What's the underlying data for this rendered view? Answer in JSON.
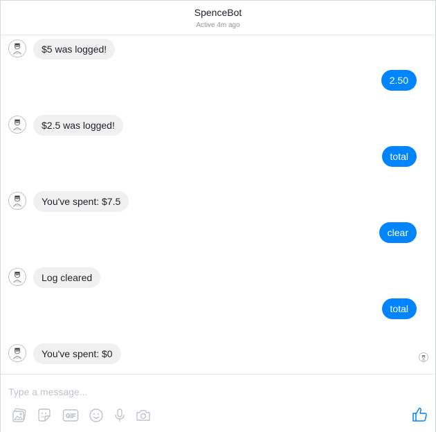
{
  "header": {
    "title": "SpenceBot",
    "status": "Active 4m ago"
  },
  "messages": [
    {
      "from": "bot",
      "text": "$5 was logged!"
    },
    {
      "from": "user",
      "text": "2.50"
    },
    {
      "from": "bot",
      "text": "$2.5 was logged!"
    },
    {
      "from": "user",
      "text": "total"
    },
    {
      "from": "bot",
      "text": "You've spent: $7.5"
    },
    {
      "from": "user",
      "text": "clear"
    },
    {
      "from": "bot",
      "text": "Log cleared"
    },
    {
      "from": "user",
      "text": "total"
    },
    {
      "from": "bot",
      "text": "You've spent: $0"
    }
  ],
  "composer": {
    "placeholder": "Type a message...",
    "tools": [
      "image-icon",
      "sticker-icon",
      "gif-icon",
      "emoji-icon",
      "microphone-icon",
      "camera-icon"
    ],
    "send_icon": "thumbs-up-icon"
  },
  "colors": {
    "outgoing_bubble": "#0084ff",
    "incoming_bubble": "#f1f0f0",
    "accent": "#0084ff"
  }
}
